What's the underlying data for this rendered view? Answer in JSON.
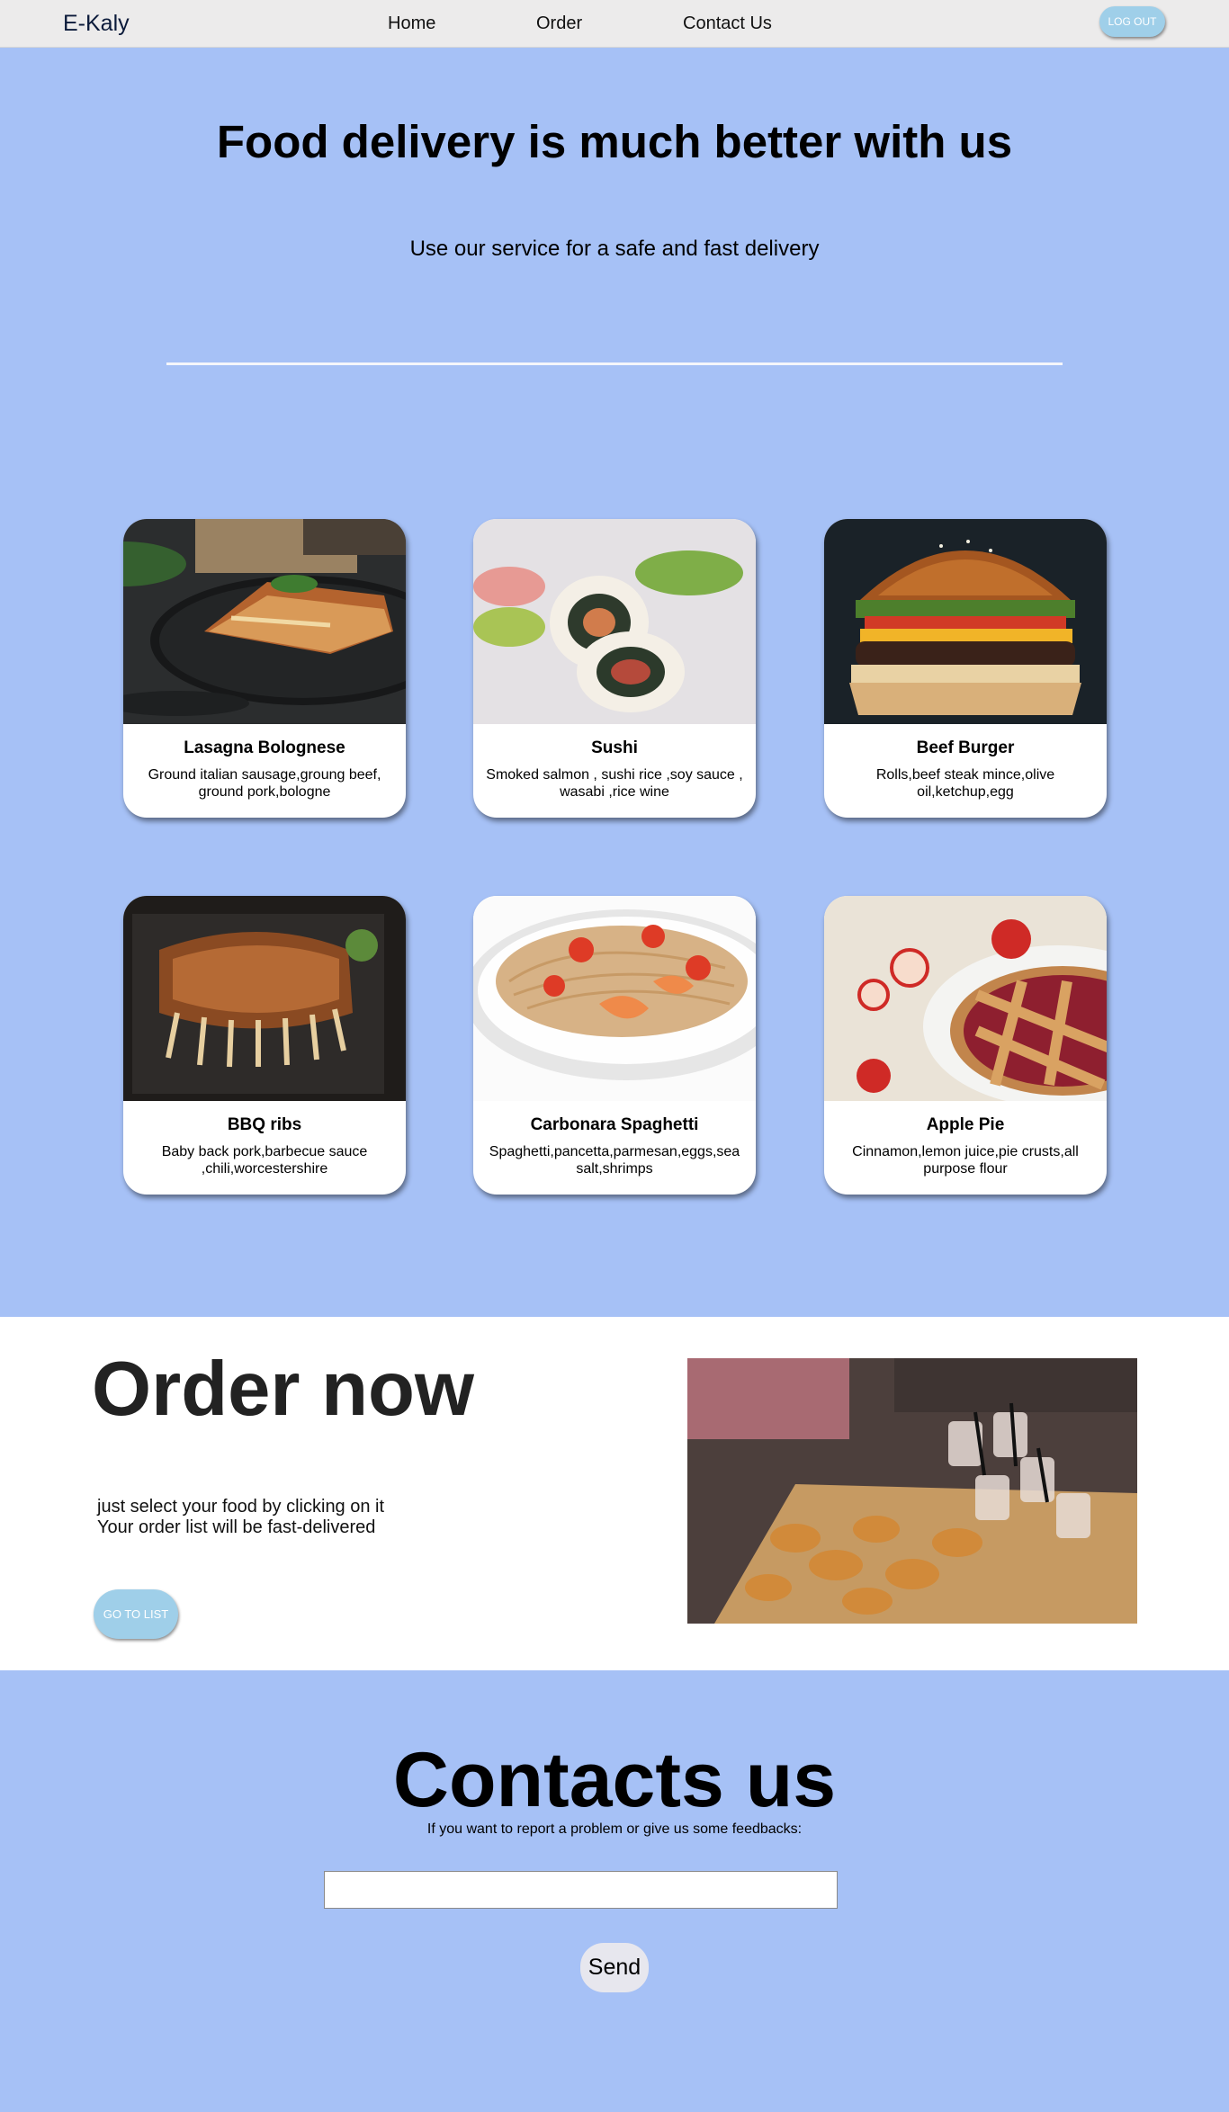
{
  "navbar": {
    "brand": "E-Kaly",
    "links": [
      "Home",
      "Order",
      "Contact Us"
    ],
    "logout_label": "LOG OUT"
  },
  "hero": {
    "title": "Food delivery is much better with us",
    "subtitle": "Use our service for a safe and fast delivery"
  },
  "menu": {
    "items": [
      {
        "name": "Lasagna Bolognese",
        "description": "Ground italian sausage,groung beef, ground pork,bologne",
        "image_icon": "lasagna-photo"
      },
      {
        "name": "Sushi",
        "description": "Smoked salmon , sushi rice ,soy sauce , wasabi ,rice wine",
        "image_icon": "sushi-photo"
      },
      {
        "name": "Beef Burger",
        "description": "Rolls,beef steak mince,olive oil,ketchup,egg",
        "image_icon": "burger-photo"
      },
      {
        "name": "BBQ ribs",
        "description": "Baby back pork,barbecue sauce ,chili,worcestershire",
        "image_icon": "ribs-photo"
      },
      {
        "name": "Carbonara Spaghetti",
        "description": "Spaghetti,pancetta,parmesan,eggs,sea salt,shrimps",
        "image_icon": "spaghetti-photo"
      },
      {
        "name": "Apple Pie",
        "description": "Cinnamon,lemon juice,pie crusts,all purpose flour",
        "image_icon": "apple-pie-photo"
      }
    ]
  },
  "order": {
    "title": "Order now",
    "line1": "just select your food by clicking on it",
    "line2": "Your order list will be fast-delivered",
    "button_label": "GO TO LIST"
  },
  "contact": {
    "title": "Contacts us",
    "subtitle": "If you want to report a problem or give us some feedbacks:",
    "input_value": "",
    "send_label": "Send"
  },
  "colors": {
    "page_background": "#a6c1f6",
    "navbar_background": "#ecebeb",
    "button_accent": "#9fcfe9"
  }
}
